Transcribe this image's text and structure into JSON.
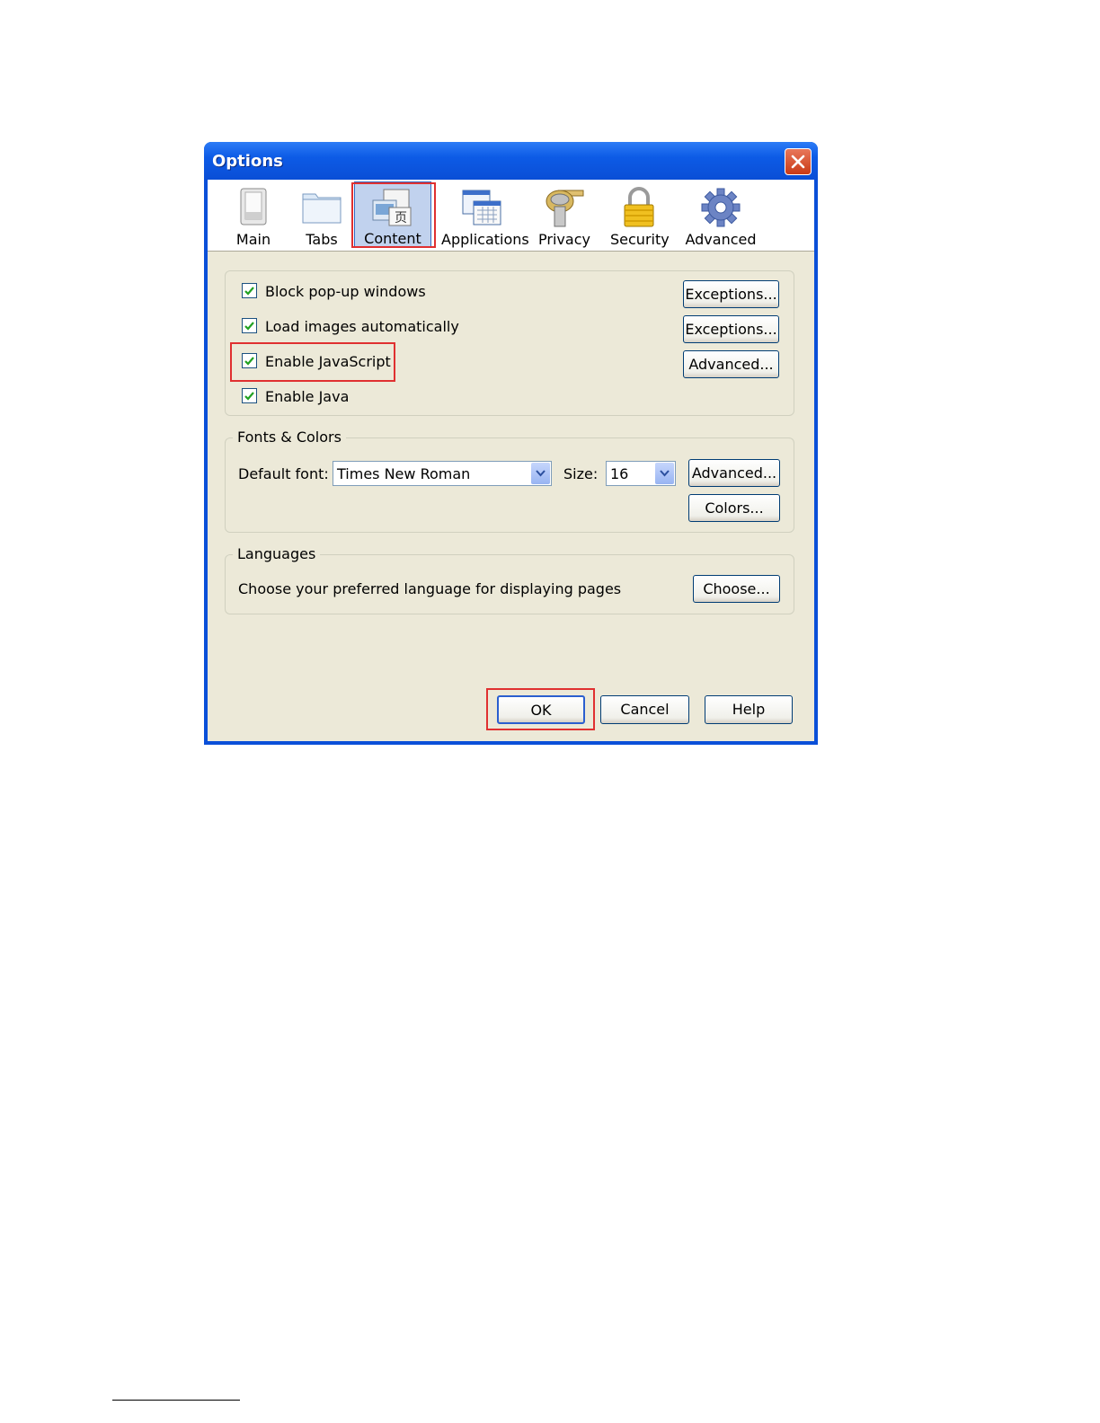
{
  "window": {
    "title": "Options"
  },
  "toolbar": {
    "items": [
      {
        "label": "Main",
        "icon": "main-icon"
      },
      {
        "label": "Tabs",
        "icon": "tabs-icon"
      },
      {
        "label": "Content",
        "icon": "content-icon",
        "selected": true
      },
      {
        "label": "Applications",
        "icon": "applications-icon"
      },
      {
        "label": "Privacy",
        "icon": "privacy-icon"
      },
      {
        "label": "Security",
        "icon": "security-icon"
      },
      {
        "label": "Advanced",
        "icon": "advanced-icon"
      }
    ]
  },
  "content": {
    "options": [
      {
        "label": "Block pop-up windows",
        "checked": true,
        "button": "Exceptions..."
      },
      {
        "label": "Load images automatically",
        "checked": true,
        "button": "Exceptions..."
      },
      {
        "label": "Enable JavaScript",
        "checked": true,
        "button": "Advanced..."
      },
      {
        "label": "Enable Java",
        "checked": true
      }
    ]
  },
  "fonts": {
    "legend": "Fonts & Colors",
    "default_font_label": "Default font:",
    "default_font_value": "Times New Roman",
    "size_label": "Size:",
    "size_value": "16",
    "advanced_button": "Advanced...",
    "colors_button": "Colors..."
  },
  "languages": {
    "legend": "Languages",
    "text": "Choose your preferred language for displaying pages",
    "choose_button": "Choose..."
  },
  "footer": {
    "ok": "OK",
    "cancel": "Cancel",
    "help": "Help"
  },
  "colors": {
    "titlebar": "#0a4ed6",
    "dialog_bg": "#ece9d8",
    "highlight": "#e03030",
    "check": "#21a121"
  }
}
